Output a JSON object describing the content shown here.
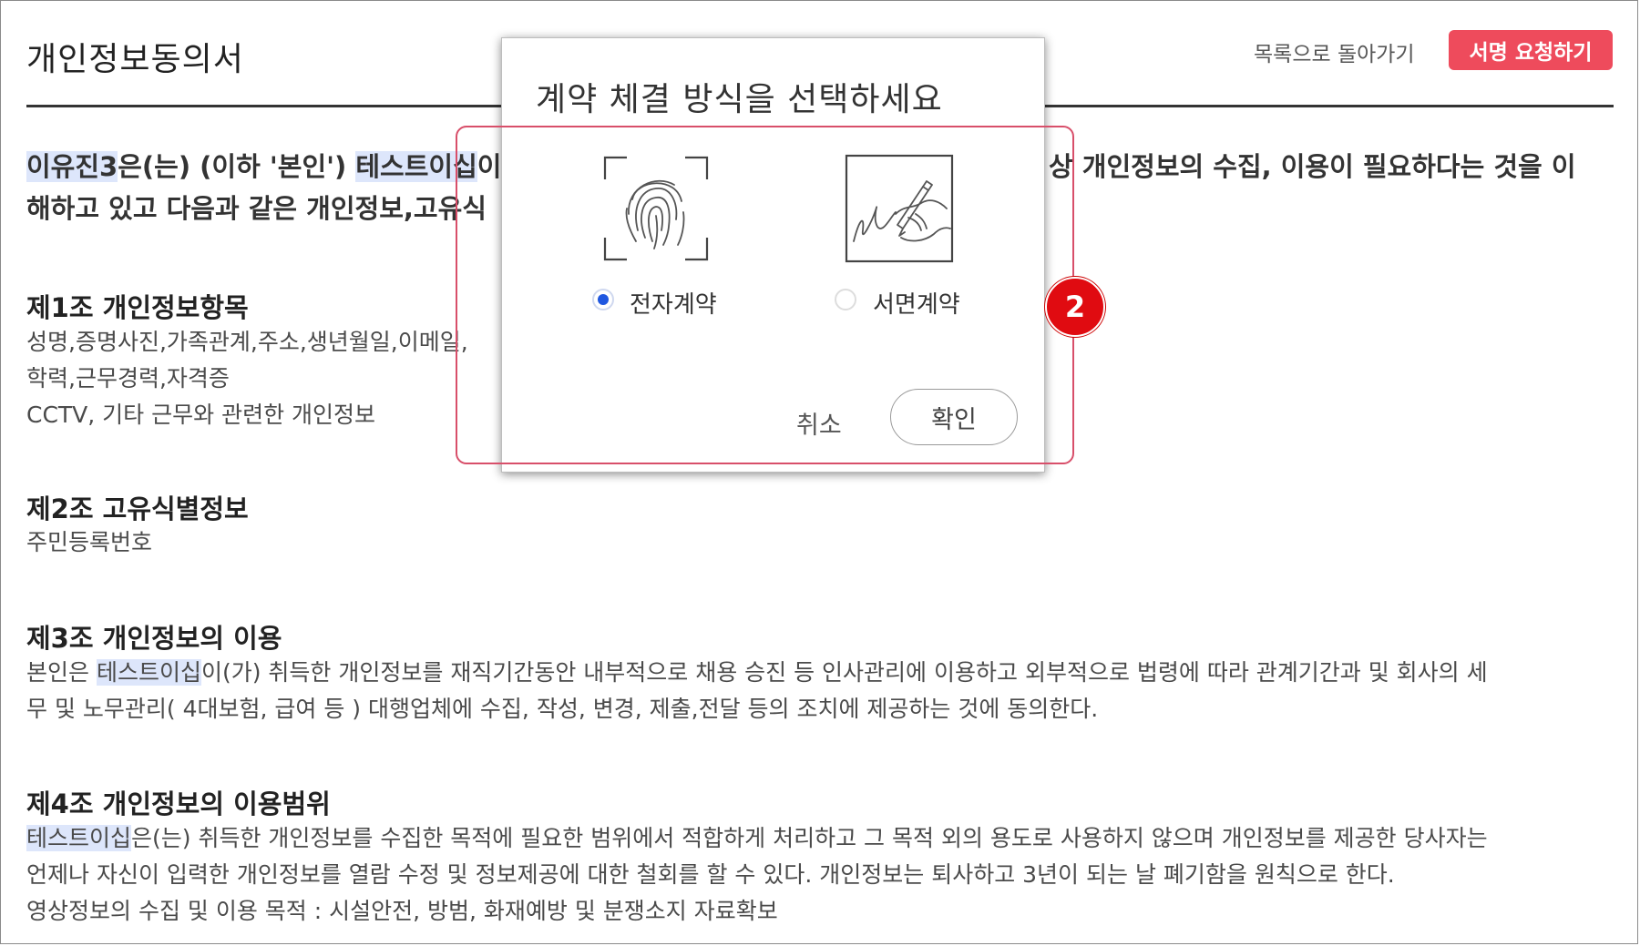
{
  "header": {
    "title": "개인정보동의서",
    "back_label": "목록으로 돌아가기",
    "sign_request_label": "서명 요청하기"
  },
  "intro": {
    "name_highlight": "이유진3",
    "text1": "은(는) (이하 '본인') ",
    "company_highlight": "테스트이십",
    "text2_partial": "이",
    "text3_partial": "상 개인정보의 수집, 이용이 필요하다는 것을 이",
    "line2_partial": "해하고 있고 다음과 같은 개인정보,고유식"
  },
  "sections": [
    {
      "title": "제1조 개인정보항목",
      "lines": [
        "성명,증명사진,가족관계,주소,생년월일,이메일,",
        "학력,근무경력,자격증",
        "CCTV, 기타 근무와 관련한 개인정보"
      ]
    },
    {
      "title": "제2조 고유식별정보",
      "lines": [
        "주민등록번호"
      ]
    },
    {
      "title": "제3조 개인정보의 이용",
      "pre": "본인은 ",
      "company_highlight": "테스트이십",
      "line1_rest": "이(가) 취득한 개인정보를 재직기간동안 내부적으로 채용 승진 등 인사관리에 이용하고 외부적으로 법령에 따라 관계기간과 및 회사의 세",
      "line2": "무 및 노무관리( 4대보험, 급여 등 ) 대행업체에 수집, 작성, 변경, 제출,전달 등의 조치에 제공하는 것에 동의한다."
    },
    {
      "title": "제4조 개인정보의 이용범위",
      "company_highlight": "테스트이십",
      "line1_rest": "은(는) 취득한 개인정보를 수집한 목적에 필요한 범위에서 적합하게 처리하고 그 목적 외의 용도로 사용하지 않으며 개인정보를 제공한 당사자는",
      "line2": "언제나 자신이 입력한 개인정보를 열람 수정 및 정보제공에 대한 철회를 할 수 있다. 개인정보는 퇴사하고 3년이 되는 날 폐기함을 원칙으로 한다.",
      "line3": "영상정보의 수집 및 이용 목적 : 시설안전, 방범, 화재예방 및 분쟁소지 자료확보"
    }
  ],
  "modal": {
    "title": "계약 체결 방식을 선택하세요",
    "options": [
      {
        "label": "전자계약",
        "icon": "fingerprint-icon",
        "selected": true
      },
      {
        "label": "서면계약",
        "icon": "hand-signature-icon",
        "selected": false
      }
    ],
    "cancel_label": "취소",
    "confirm_label": "확인"
  },
  "annotation": {
    "step_number": "2",
    "badge_color": "#e00b11",
    "box_color": "#d84f6a"
  },
  "colors": {
    "accent": "#ee4b5c",
    "highlight": "#dde6fb",
    "radio_selected": "#1f57e0"
  }
}
